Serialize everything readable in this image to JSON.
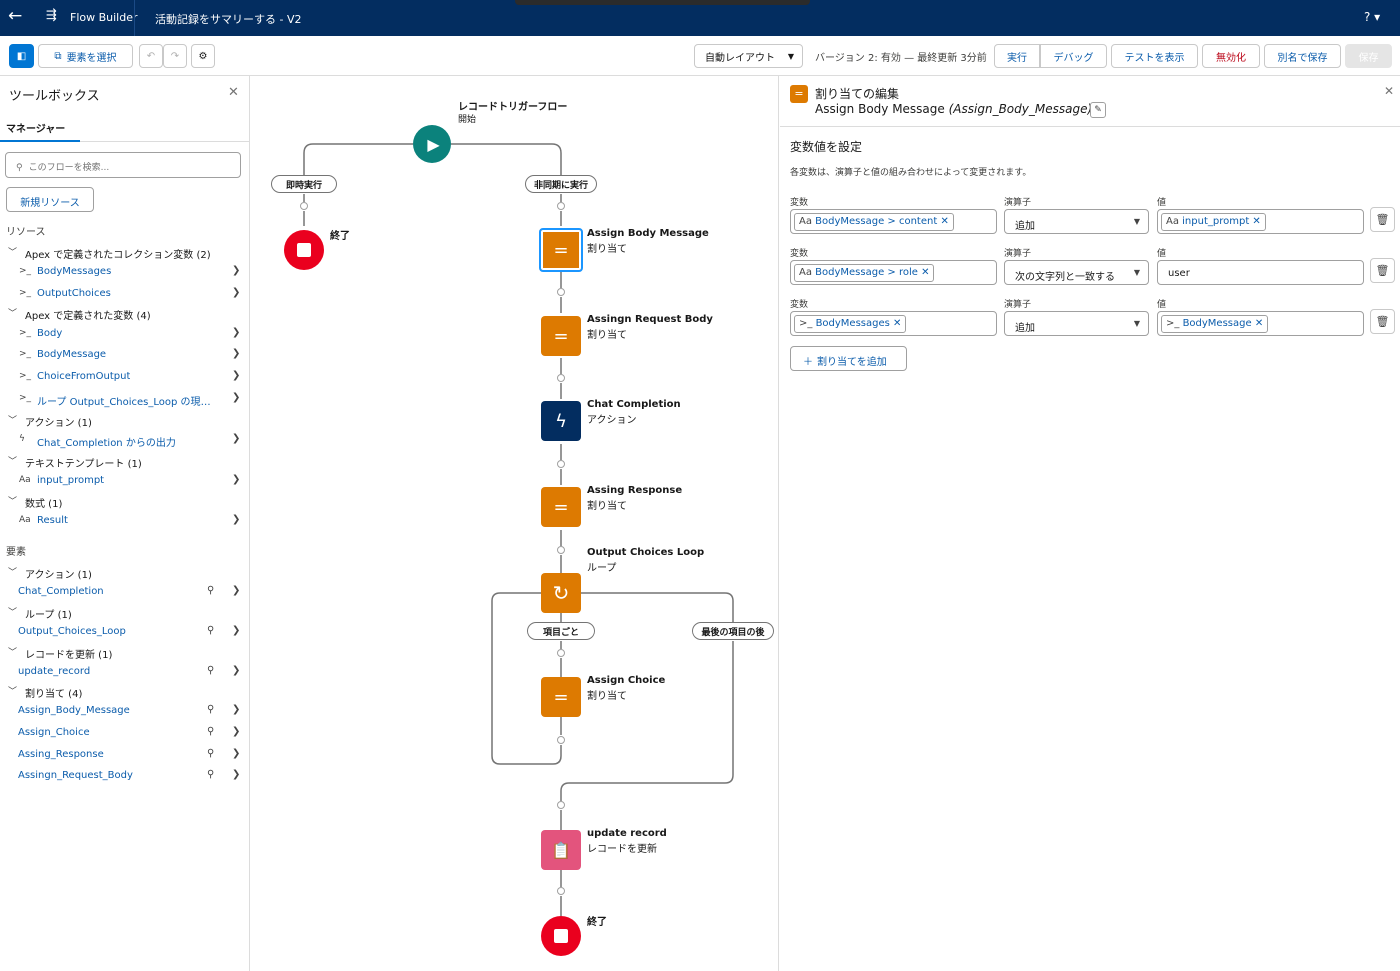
{
  "topbar": {
    "back_icon": "←",
    "app_name": "Flow Builder",
    "flow_title": "活動記録をサマリーする - V2",
    "help": "? ▾"
  },
  "toolbar": {
    "select_elements": "要素を選択",
    "layout": "自動レイアウト",
    "version_info": "バージョン 2: 有効 — 最終更新 3分前",
    "run": "実行",
    "debug": "デバッグ",
    "show_tests": "テストを表示",
    "deactivate": "無効化",
    "save_as": "別名で保存",
    "save": "保存"
  },
  "toolbox": {
    "title": "ツールボックス",
    "tab": "マネージャー",
    "search_placeholder": "このフローを検索...",
    "new_resource": "新規リソース",
    "resources_header": "リソース",
    "groups": {
      "apex_collection": "Apex で定義されたコレクション変数 (2)",
      "apex_vars": "Apex で定義された変数 (4)",
      "actions": "アクション (1)",
      "text_templates": "テキストテンプレート (1)",
      "formulas": "数式 (1)"
    },
    "resources": {
      "body_messages": "BodyMessages",
      "output_choices": "OutputChoices",
      "body": "Body",
      "body_message": "BodyMessage",
      "choice_from_output": "ChoiceFromOutput",
      "loop_current": "ループ Output_Choices_Loop の現在の項目",
      "chat_output": "Chat_Completion からの出力",
      "input_prompt": "input_prompt",
      "result": "Result"
    },
    "elements_header": "要素",
    "element_groups": {
      "actions": "アクション (1)",
      "loops": "ループ (1)",
      "update_records": "レコードを更新 (1)",
      "assignments": "割り当て (4)"
    },
    "elements": {
      "chat_completion": "Chat_Completion",
      "output_choices_loop": "Output_Choices_Loop",
      "update_record": "update_record",
      "assign_body_message": "Assign_Body_Message",
      "assign_choice": "Assign_Choice",
      "assing_response": "Assing_Response",
      "assingn_request_body": "Assingn_Request_Body"
    }
  },
  "canvas": {
    "start_title": "レコードトリガーフロー",
    "start_sub": "開始",
    "immediate": "即時実行",
    "async": "非同期に実行",
    "end": "終了",
    "nodes": {
      "assign_body": {
        "label": "Assign Body Message",
        "sub": "割り当て"
      },
      "assign_request": {
        "label": "Assingn Request Body",
        "sub": "割り当て"
      },
      "chat": {
        "label": "Chat Completion",
        "sub": "アクション"
      },
      "response": {
        "label": "Assing Response",
        "sub": "割り当て"
      },
      "loop": {
        "label": "Output Choices Loop",
        "sub": "ループ"
      },
      "choice": {
        "label": "Assign Choice",
        "sub": "割り当て"
      },
      "update": {
        "label": "update record",
        "sub": "レコードを更新"
      }
    },
    "for_each": "項目ごと",
    "after_last": "最後の項目の後",
    "end2": "終了"
  },
  "panel": {
    "title": "割り当ての編集",
    "name": "Assign Body Message",
    "api_name": "(Assign_Body_Message)",
    "section": "変数値を設定",
    "description": "各変数は、演算子と値の組み合わせによって変更されます。",
    "label_variable": "変数",
    "label_operator": "演算子",
    "label_value": "値",
    "rows": [
      {
        "variable": "BodyMessage > content",
        "operator": "追加",
        "value": "input_prompt"
      },
      {
        "variable": "BodyMessage > role",
        "operator": "次の文字列と一致する",
        "value": "user"
      },
      {
        "variable": "BodyMessages",
        "operator": "追加",
        "value": "BodyMessage"
      }
    ],
    "add_assignment": "割り当てを追加"
  },
  "colors": {
    "header": "#032d60",
    "assignment": "#dd7a01",
    "action": "#032d60",
    "start": "#0b827c",
    "end": "#ea001e",
    "update": "#e3547d"
  }
}
